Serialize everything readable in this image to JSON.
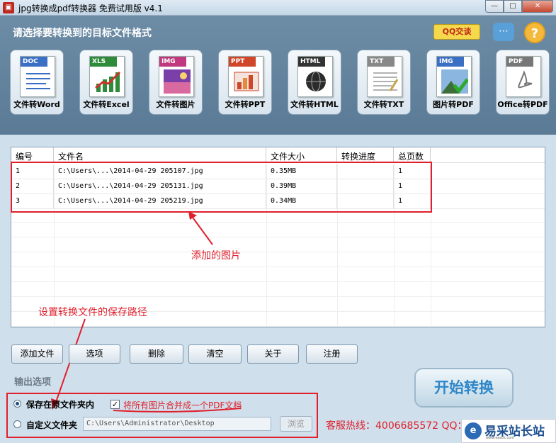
{
  "window": {
    "title": "jpg转换成pdf转换器 免费试用版 v4.1",
    "controls": {
      "minimize": "—",
      "maximize": "□",
      "close": "✕"
    }
  },
  "header": {
    "title": "请选择要转换到的目标文件格式",
    "qq_label": "QQ交谈",
    "chat_icon": "chat-bubble",
    "help_label": "?"
  },
  "tools": [
    {
      "tag": "DOC",
      "label": "文件转Word",
      "color": "#3a6fc4",
      "icon": "word-doc-icon"
    },
    {
      "tag": "XLS",
      "label": "文件转Excel",
      "color": "#2e8b3a",
      "icon": "excel-chart-icon"
    },
    {
      "tag": "IMG",
      "label": "文件转图片",
      "color": "#c0397e",
      "icon": "image-icon"
    },
    {
      "tag": "PPT",
      "label": "文件转PPT",
      "color": "#d0462a",
      "icon": "ppt-icon"
    },
    {
      "tag": "HTML",
      "label": "文件转HTML",
      "color": "#333333",
      "icon": "html-globe-icon"
    },
    {
      "tag": "TXT",
      "label": "文件转TXT",
      "color": "#888888",
      "icon": "txt-icon"
    },
    {
      "tag": "IMG",
      "label": "图片转PDF",
      "color": "#3a6fc4",
      "icon": "image-to-pdf-icon"
    },
    {
      "tag": "PDF",
      "label": "Office转PDF",
      "color": "#777777",
      "icon": "pdf-icon"
    }
  ],
  "table": {
    "headers": [
      "编号",
      "文件名",
      "文件大小",
      "转换进度",
      "总页数"
    ],
    "rows": [
      {
        "no": "1",
        "name": "C:\\Users\\...\\2014-04-29 205107.jpg",
        "size": "0.35MB",
        "progress": "",
        "pages": "1"
      },
      {
        "no": "2",
        "name": "C:\\Users\\...\\2014-04-29 205131.jpg",
        "size": "0.39MB",
        "progress": "",
        "pages": "1"
      },
      {
        "no": "3",
        "name": "C:\\Users\\...\\2014-04-29 205219.jpg",
        "size": "0.34MB",
        "progress": "",
        "pages": "1"
      }
    ]
  },
  "annotations": {
    "images_added": "添加的图片",
    "save_path": "设置转换文件的保存路径"
  },
  "buttons": {
    "add_file": "添加文件",
    "options": "选项",
    "delete": "删除",
    "clear": "清空",
    "about": "关于",
    "register": "注册"
  },
  "output": {
    "section_label": "输出选项",
    "save_in_source": "保存在原文件夹内",
    "merge_pdf": "将所有图片合并成一个PDF文档",
    "custom_folder": "自定义文件夹",
    "path_value": "C:\\Users\\Administrator\\Desktop",
    "browse": "浏览",
    "selected": "save_in_source",
    "merge_checked": true
  },
  "start_button": "开始转换",
  "hotline": "客服热线：4006685572 QQ：",
  "watermark": {
    "text": "易采站长站",
    "sub": "www.easck.com"
  }
}
